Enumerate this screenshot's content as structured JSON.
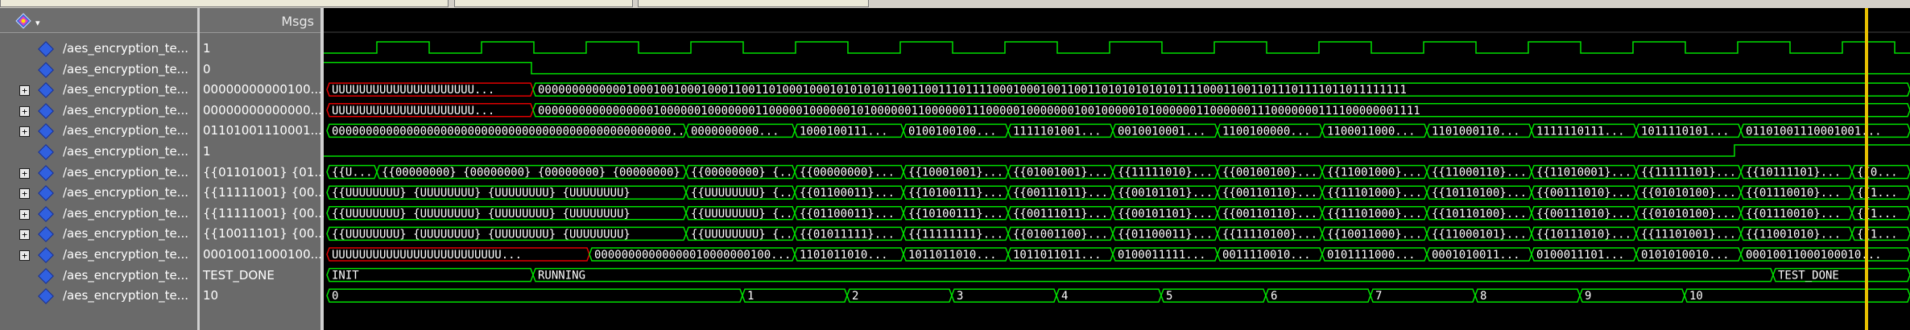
{
  "header": {
    "msgs_label": "Msgs",
    "wave_icon": "wave-tool-icon"
  },
  "signals": [
    {
      "name": "/aes_encryption_te...",
      "value": "1",
      "expandable": false
    },
    {
      "name": "/aes_encryption_te...",
      "value": "0",
      "expandable": false
    },
    {
      "name": "/aes_encryption_te...",
      "value": "00000000000100...",
      "expandable": true
    },
    {
      "name": "/aes_encryption_te...",
      "value": "00000000000000...",
      "expandable": true
    },
    {
      "name": "/aes_encryption_te...",
      "value": "01101001110001...",
      "expandable": true
    },
    {
      "name": "/aes_encryption_te...",
      "value": "1",
      "expandable": false
    },
    {
      "name": "/aes_encryption_te...",
      "value": "{{01101001} {01...",
      "expandable": true
    },
    {
      "name": "/aes_encryption_te...",
      "value": "{{11111001} {00...",
      "expandable": true
    },
    {
      "name": "/aes_encryption_te...",
      "value": "{{11111001} {00...",
      "expandable": true
    },
    {
      "name": "/aes_encryption_te...",
      "value": "{{10011101} {00...",
      "expandable": true
    },
    {
      "name": "/aes_encryption_te...",
      "value": "00010011000100...",
      "expandable": true
    },
    {
      "name": "/aes_encryption_te...",
      "value": "TEST_DONE",
      "expandable": false
    },
    {
      "name": "/aes_encryption_te...",
      "value": "10",
      "expandable": false
    }
  ],
  "waves": {
    "bus1": [
      "UUUUUUUUUUUUUUUUUUUUU...",
      "00000000000001000100100010001100110100010001010101011001100111011110001000100110011010101010101111000110011011101111011011111111"
    ],
    "bus2": [
      "UUUUUUUUUUUUUUUUUUUUU...",
      "0000000000000000010000001000000011000001000000101000000110000001110000010000000100100000101000000110000001110000000111100000001111"
    ],
    "bus3": [
      "00000000000000000000000000000000000000000000000000...",
      "0000000000...",
      "1000100111...",
      "0100100100...",
      "1111101001...",
      "0010010001...",
      "1100100000...",
      "1100011000...",
      "1101000110...",
      "1111110111...",
      "1011110101...",
      "01101001110001001..."
    ],
    "arr1": [
      "{{U...",
      "{{00000000} {00000000} {00000000} {00000000}",
      "{{00000000} {...",
      "{{00000000}...",
      "{{10001001}...",
      "{{01001001}...",
      "{{11111010}...",
      "{{00100100}...",
      "{{11001000}...",
      "{{11000110}...",
      "{{11010001}...",
      "{{11111101}...",
      "{{10111101}...",
      "{{0..."
    ],
    "arr2": [
      "{{UUUUUUUU} {UUUUUUUU} {UUUUUUUU} {UUUUUUUU}",
      "{{UUUUUUUU} {...",
      "{{01100011}...",
      "{{10100111}...",
      "{{00111011}...",
      "{{00101101}...",
      "{{00110110}...",
      "{{11101000}...",
      "{{10110100}...",
      "{{00111010}...",
      "{{01010100}...",
      "{{01110010}...",
      "{{1..."
    ],
    "arr3": [
      "{{UUUUUUUU} {UUUUUUUU} {UUUUUUUU} {UUUUUUUU}",
      "{{UUUUUUUU} {...",
      "{{01100011}...",
      "{{10100111}...",
      "{{00111011}...",
      "{{00101101}...",
      "{{00110110}...",
      "{{11101000}...",
      "{{10110100}...",
      "{{00111010}...",
      "{{01010100}...",
      "{{01110010}...",
      "{{1..."
    ],
    "arr4": [
      "{{UUUUUUUU} {UUUUUUUU} {UUUUUUUU} {UUUUUUUU}",
      "{{UUUUUUUU} {...",
      "{{01011111}...",
      "{{11111111}...",
      "{{01001100}...",
      "{{01100011}...",
      "{{11110100}...",
      "{{10011000}...",
      "{{11000101}...",
      "{{10111010}...",
      "{{11101001}...",
      "{{11001010}...",
      "{{1..."
    ],
    "bus4": [
      "UUUUUUUUUUUUUUUUUUUUUUUUU...",
      "00000000000000010000000100...",
      "1101011010...",
      "1011011010...",
      "1011011011...",
      "0100011111...",
      "0011110010...",
      "0101111000...",
      "0001010011...",
      "0100011101...",
      "0101010010...",
      "00010011000100010..."
    ],
    "state": [
      "INIT",
      "RUNNING",
      "TEST_DONE"
    ],
    "counter": [
      "0",
      "1",
      "2",
      "3",
      "4",
      "5",
      "6",
      "7",
      "8",
      "9",
      "10"
    ]
  },
  "colors": {
    "signal": "#00e000",
    "undefined": "#e00000",
    "cursor": "#e8c000",
    "background": "#000000"
  }
}
